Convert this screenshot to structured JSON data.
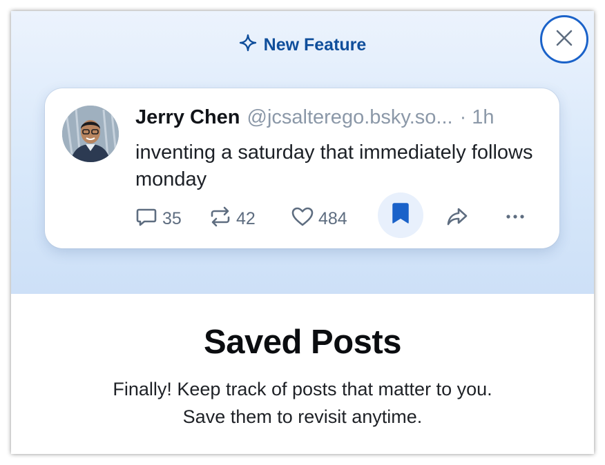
{
  "badge": {
    "label": "New Feature",
    "icon": "sparkle-icon",
    "color": "#0f4e9b"
  },
  "close": {
    "icon": "close-icon"
  },
  "post": {
    "author": "Jerry Chen",
    "handle": "@jcsalterego.bsky.so...",
    "separator": "·",
    "time": "1h",
    "text": "inventing a saturday that immediately follows monday",
    "actions": {
      "replies": "35",
      "reposts": "42",
      "likes": "484",
      "bookmark_icon": "bookmark-filled-icon",
      "share_icon": "share-arrow-icon",
      "more_icon": "more-dots-icon"
    }
  },
  "title": "Saved Posts",
  "description": {
    "line1": "Finally! Keep track of posts that matter to you.",
    "line2": "Save them to revisit anytime."
  },
  "colors": {
    "accent": "#1a62c9",
    "muted": "#5e6d80"
  }
}
